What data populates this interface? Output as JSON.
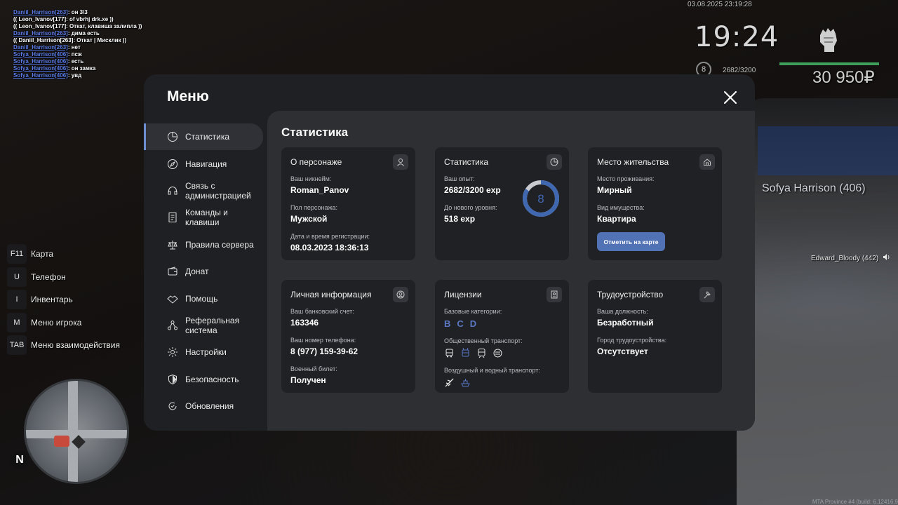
{
  "chat": [
    {
      "name": "Daniil_Harrison[263]",
      "text": ": он 3\\3"
    },
    {
      "name": "",
      "text": "(( Leon_Ivanov[177]: of vbrhj drk.xe ))"
    },
    {
      "name": "",
      "text": "(( Leon_Ivanov[177]: Откат, клавиша залипла ))"
    },
    {
      "name": "Daniil_Harrison[263]",
      "text": ": дима есть"
    },
    {
      "name": "",
      "text": "(( Daniil_Harrison[263]: Откат | Мисклик ))"
    },
    {
      "name": "Daniil_Harrison[263]",
      "text": ": нет"
    },
    {
      "name": "Sofya_Harrison[406]",
      "text": ": псж"
    },
    {
      "name": "Sofya_Harrison[406]",
      "text": ": есть"
    },
    {
      "name": "Sofya_Harrison[406]",
      "text": ": он замка"
    },
    {
      "name": "Sofya_Harrison[406]",
      "text": ": увд"
    }
  ],
  "hud": {
    "date": "03.08.2025 23:19:28",
    "time": "19:24",
    "level": "8",
    "exp": "2682/3200",
    "money": "30 950₽"
  },
  "nametag": "Sofya Harrison (406)",
  "voice": "Edward_Bloody (442)",
  "build": "MTA Province #4 (build: 6.12416.9",
  "hotkeys": [
    {
      "key": "F11",
      "label": "Карта"
    },
    {
      "key": "U",
      "label": "Телефон"
    },
    {
      "key": "I",
      "label": "Инвентарь"
    },
    {
      "key": "M",
      "label": "Меню игрока"
    },
    {
      "key": "TAB",
      "label": "Меню взаимодействия"
    }
  ],
  "compass": "N",
  "menu": {
    "title": "Меню",
    "sidebar": [
      {
        "label": "Статистика",
        "icon": "pie-chart-icon",
        "active": true
      },
      {
        "label": "Навигация",
        "icon": "compass-icon"
      },
      {
        "label": "Связь с администрацией",
        "icon": "headset-icon"
      },
      {
        "label": "Команды и клавиши",
        "icon": "document-icon"
      },
      {
        "label": "Правила сервера",
        "icon": "scales-icon"
      },
      {
        "label": "Донат",
        "icon": "wallet-icon"
      },
      {
        "label": "Помощь",
        "icon": "handshake-icon"
      },
      {
        "label": "Реферальная система",
        "icon": "network-icon"
      },
      {
        "label": "Настройки",
        "icon": "gear-icon"
      },
      {
        "label": "Безопасность",
        "icon": "shield-icon"
      },
      {
        "label": "Обновления",
        "icon": "refresh-icon"
      }
    ],
    "content_title": "Статистика",
    "cards": {
      "character": {
        "title": "О персонаже",
        "nickname_label": "Ваш никнейм:",
        "nickname": "Roman_Panov",
        "gender_label": "Пол персонажа:",
        "gender": "Мужской",
        "reg_label": "Дата и время регистрации:",
        "reg": "08.03.2023 18:36:13"
      },
      "stats": {
        "title": "Статистика",
        "exp_label": "Ваш опыт:",
        "exp": "2682/3200 exp",
        "next_label": "До нового уровня:",
        "next": "518 exp",
        "level": "8",
        "progress": 0.838
      },
      "residence": {
        "title": "Место жительства",
        "place_label": "Место проживания:",
        "place": "Мирный",
        "property_label": "Вид имущества:",
        "property": "Квартира",
        "map_button": "Отметить на карте"
      },
      "personal": {
        "title": "Личная информация",
        "bank_label": "Ваш банковский счет:",
        "bank": "163346",
        "phone_label": "Ваш номер телефона:",
        "phone": "8 (977) 159-39-62",
        "military_label": "Военный билет:",
        "military": "Получен"
      },
      "licenses": {
        "title": "Лицензии",
        "base_label": "Базовые категории:",
        "base": [
          "B",
          "C",
          "D"
        ],
        "public_label": "Общественный транспорт:",
        "air_label": "Воздушный и водный транспорт:"
      },
      "job": {
        "title": "Трудоустройство",
        "position_label": "Ваша должность:",
        "position": "Безработный",
        "city_label": "Город трудоустройства:",
        "city": "Отсутствует"
      }
    }
  },
  "colors": {
    "accent": "#5272b6",
    "ring": "#3f68b0",
    "panel": "#1f2023",
    "content": "#2e2f33",
    "card": "#202124"
  }
}
